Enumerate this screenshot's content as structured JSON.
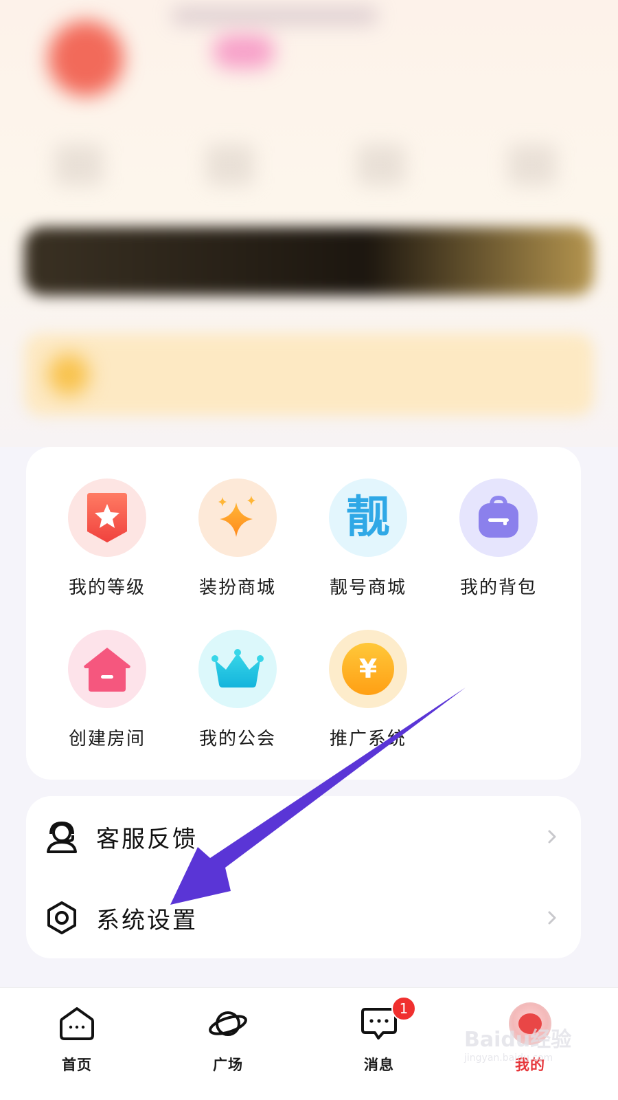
{
  "grid": {
    "items": [
      {
        "label": "我的等级",
        "icon": "level-shield-icon"
      },
      {
        "label": "装扮商城",
        "icon": "sparkle-star-icon"
      },
      {
        "label": "靓号商城",
        "icon": "liang-character-icon",
        "glyph": "靓"
      },
      {
        "label": "我的背包",
        "icon": "backpack-icon"
      },
      {
        "label": "创建房间",
        "icon": "house-icon"
      },
      {
        "label": "我的公会",
        "icon": "crown-icon"
      },
      {
        "label": "推广系统",
        "icon": "yen-coin-icon",
        "glyph": "¥"
      }
    ]
  },
  "list": {
    "items": [
      {
        "label": "客服反馈",
        "icon": "headset-agent-icon"
      },
      {
        "label": "系统设置",
        "icon": "hexagon-settings-icon"
      }
    ]
  },
  "nav": {
    "items": [
      {
        "label": "首页",
        "icon": "home-chat-icon"
      },
      {
        "label": "广场",
        "icon": "planet-icon"
      },
      {
        "label": "消息",
        "icon": "message-icon",
        "badge": "1"
      },
      {
        "label": "我的",
        "icon": "avatar-icon",
        "active": true
      }
    ]
  },
  "watermark": {
    "main": "Baidu经验",
    "sub": "jingyan.baidu.com"
  },
  "colors": {
    "accent_active": "#e6363a",
    "badge": "#f0302f",
    "annotation_arrow": "#5a35d6"
  }
}
